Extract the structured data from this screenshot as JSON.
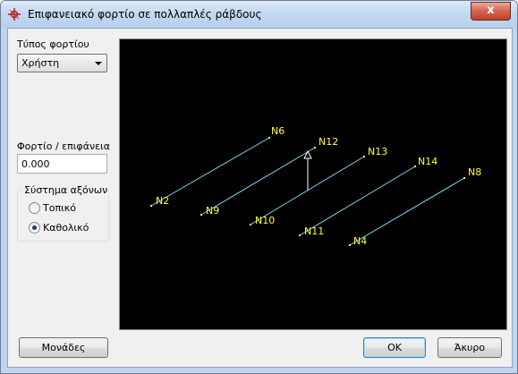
{
  "window": {
    "title": "Επιφανειακό φορτίο σε πολλαπλές ράβδους",
    "close_label": "x"
  },
  "load_type": {
    "label": "Τύπος φορτίου",
    "selected": "Χρήστη"
  },
  "load_value": {
    "label": "Φορτίο / επιφάνεια",
    "value": "0.000"
  },
  "axis_system": {
    "title": "Σύστημα αξόνων",
    "options": [
      "Τοπικό",
      "Καθολικό"
    ],
    "selected": "Καθολικό"
  },
  "buttons": {
    "units": "Μονάδες",
    "ok": "OK",
    "cancel": "Άκυρο"
  },
  "viewport": {
    "background": "#000000",
    "member_color": "#7fd6f0",
    "node_color": "#ffff33",
    "nodes": [
      "N6",
      "N2",
      "N12",
      "N9",
      "N13",
      "N10",
      "N14",
      "N11",
      "N8",
      "N4"
    ]
  }
}
